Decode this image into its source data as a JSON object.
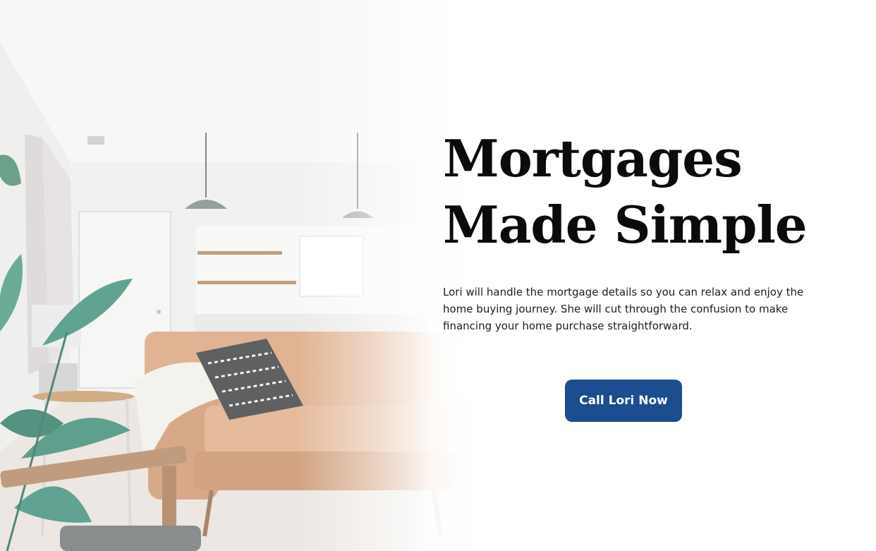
{
  "hero": {
    "headline_line1": "Mortgages",
    "headline_line2": "Made Simple",
    "description": "Lori will handle the mortgage details so you can relax and enjoy the home buying journey. She will cut through the confusion to make financing your home purchase straightforward.",
    "cta_label": "Call Lori Now",
    "photo_icon": "living-room-photo"
  },
  "colors": {
    "accent": "#1b4d8f",
    "headline_text": "#0b0b0b",
    "body_text": "#1d1d1d",
    "background": "#ffffff"
  }
}
